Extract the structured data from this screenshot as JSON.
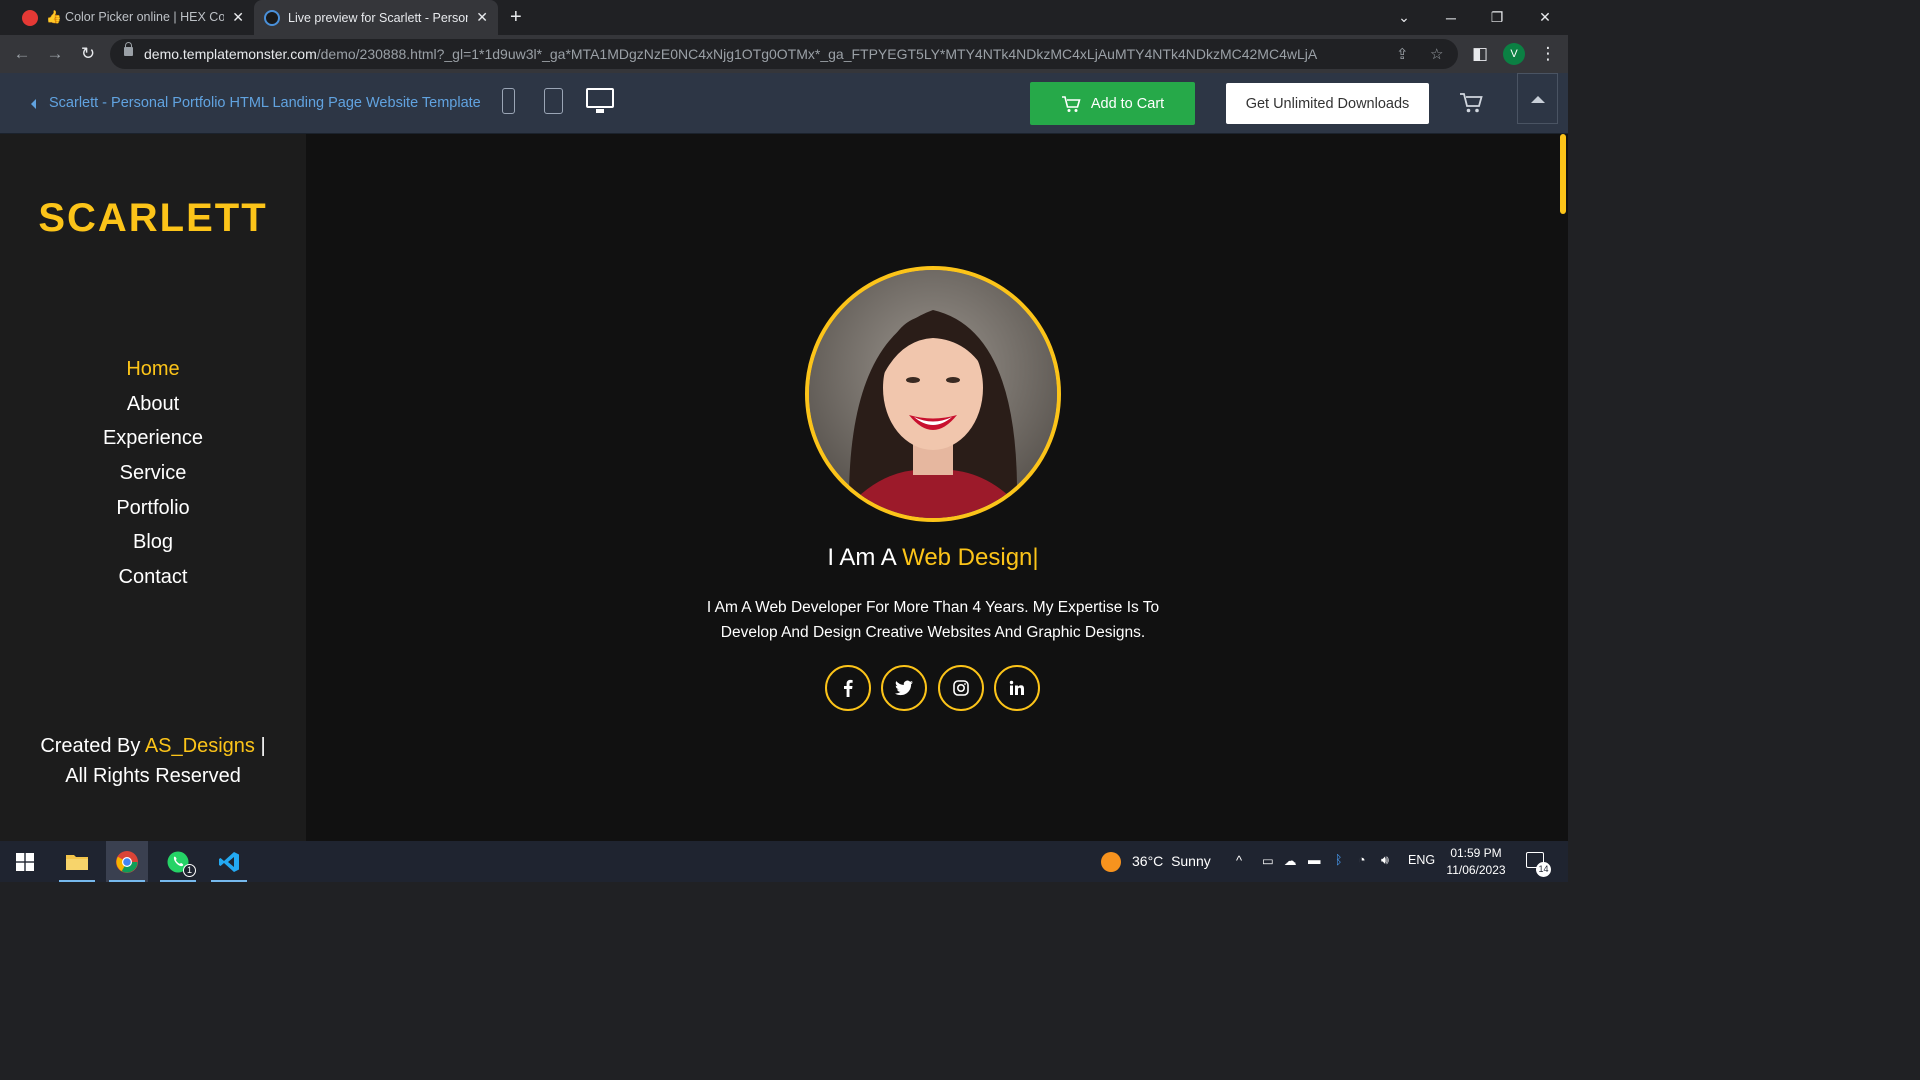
{
  "browser": {
    "tabs": [
      {
        "title": "👍 Color Picker online | HEX Colo",
        "favicon_color": "#e53935",
        "active": false
      },
      {
        "title": "Live preview for Scarlett - Person",
        "favicon_color": "#4a90d9",
        "active": true
      }
    ],
    "address": {
      "host": "demo.templatemonster.com",
      "path": "/demo/230888.html?_gl=1*1d9uw3l*_ga*MTA1MDgzNzE0NC4xNjg1OTg0OTMx*_ga_FTPYEGT5LY*MTY4NTk4NDkzMC4xLjAuMTY4NTk4NDkzMC42MC4wLjA"
    },
    "profile_initial": "V"
  },
  "demo_bar": {
    "title": "Scarlett - Personal Portfolio HTML Landing Page Website Template",
    "add_to_cart": "Add to Cart",
    "unlimited": "Get Unlimited Downloads"
  },
  "site": {
    "brand": "SCARLETT",
    "nav": [
      "Home",
      "About",
      "Experience",
      "Service",
      "Portfolio",
      "Blog",
      "Contact"
    ],
    "active_nav": "Home",
    "credits": {
      "prefix": "Created By ",
      "author": "AS_Designs",
      "suffix": " |",
      "line2": "All Rights Reserved"
    },
    "headline": {
      "prefix": "I Am A ",
      "highlight": "Web Design|"
    },
    "intro": [
      "I Am A Web Developer For More Than 4 Years. My Expertise Is To",
      "Develop And Design Creative Websites And Graphic Designs."
    ],
    "social": [
      "facebook-icon",
      "twitter-icon",
      "instagram-icon",
      "linkedin-icon"
    ],
    "accent_color": "#fcc419"
  },
  "taskbar": {
    "weather": {
      "temp": "36°C",
      "condition": "Sunny"
    },
    "language": "ENG",
    "time": "01:59 PM",
    "date": "11/06/2023",
    "notifications": "14",
    "whatsapp_badge": "1"
  }
}
